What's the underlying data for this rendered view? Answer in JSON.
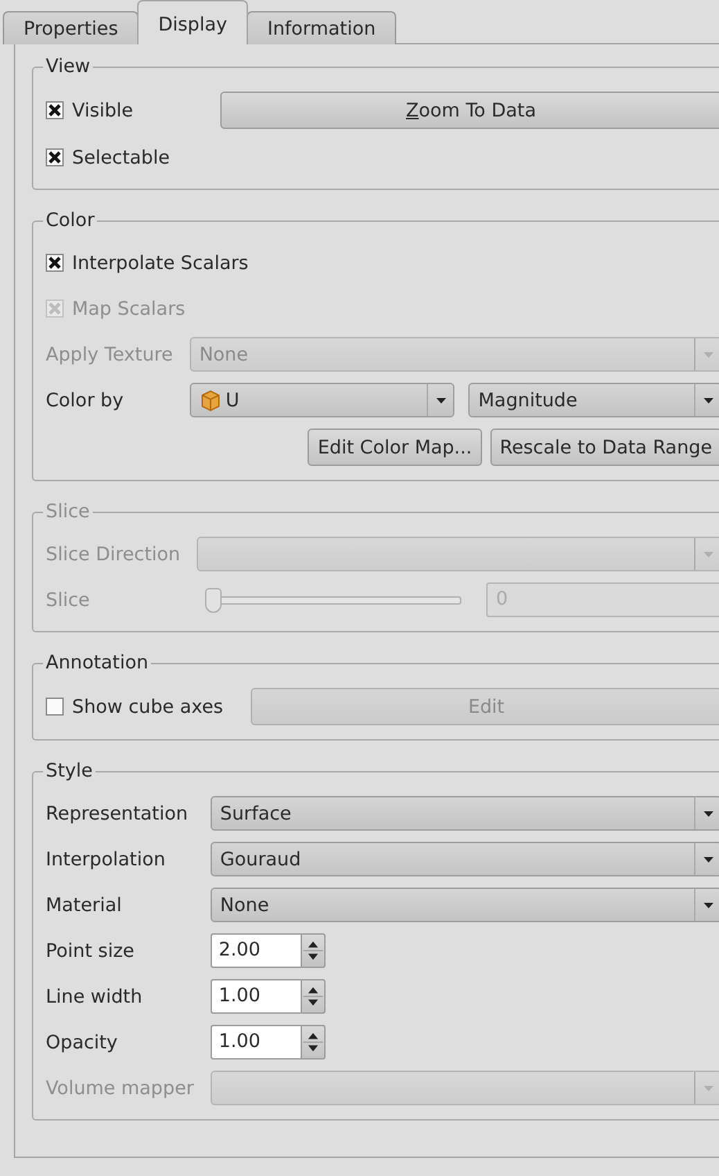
{
  "tabs": [
    {
      "label": "Properties",
      "selected": false
    },
    {
      "label": "Display",
      "selected": true
    },
    {
      "label": "Information",
      "selected": false
    }
  ],
  "sections": [
    {
      "title": "View",
      "disabled": false,
      "rows": [
        {
          "kind": "checkbox_button",
          "checkbox": {
            "label": "Visible",
            "checked": true,
            "disabled": false
          },
          "button": {
            "label": "Zoom To Data",
            "underlined_first_letter": true,
            "disabled": false
          }
        },
        {
          "kind": "checkbox",
          "label": "Selectable",
          "checked": true,
          "disabled": false
        }
      ]
    },
    {
      "title": "Color",
      "disabled": false,
      "rows": [
        {
          "kind": "checkbox",
          "label": "Interpolate Scalars",
          "checked": true,
          "disabled": false
        },
        {
          "kind": "checkbox",
          "label": "Map Scalars",
          "checked": true,
          "disabled": true
        },
        {
          "kind": "combo",
          "label": "Apply Texture",
          "value": "None",
          "disabled": true
        },
        {
          "kind": "combo_pair",
          "label": "Color by",
          "disabled": false,
          "combos": [
            {
              "value": "U",
              "disabled": false
            },
            {
              "value": "Magnitude",
              "disabled": false
            }
          ]
        },
        {
          "kind": "buttons",
          "buttons": [
            {
              "label": "Edit Color Map...",
              "disabled": false
            },
            {
              "label": "Rescale to Data Range",
              "disabled": false
            }
          ]
        }
      ]
    },
    {
      "title": "Slice",
      "disabled": true,
      "rows": [
        {
          "kind": "combo",
          "label": "Slice Direction",
          "disabled": true
        },
        {
          "kind": "slider",
          "label": "Slice",
          "level": 0,
          "reading": "0",
          "disabled": true
        }
      ]
    },
    {
      "title": "Annotation",
      "disabled": false,
      "rows": [
        {
          "kind": "checkbox_button",
          "checkbox": {
            "label": "Show cube axes",
            "checked": false,
            "disabled": false
          },
          "button": {
            "label": "Edit",
            "underlined_first_letter": false,
            "disabled": true
          }
        }
      ]
    },
    {
      "title": "Style",
      "disabled": false,
      "rows": [
        {
          "kind": "combo",
          "label": "Representation",
          "value": "Surface",
          "disabled": false
        },
        {
          "kind": "combo",
          "label": "Interpolation",
          "value": "Gouraud",
          "disabled": false
        },
        {
          "kind": "combo",
          "label": "Material",
          "value": "None",
          "disabled": false
        },
        {
          "kind": "spinbox",
          "label": "Point size",
          "value": "2.00",
          "disabled": false
        },
        {
          "kind": "spinbox",
          "label": "Line width",
          "value": "1.00",
          "disabled": false
        },
        {
          "kind": "spinbox",
          "label": "Opacity",
          "value": "1.00",
          "disabled": false
        },
        {
          "kind": "combo",
          "label": "Volume mapper",
          "disabled": true
        }
      ]
    }
  ]
}
